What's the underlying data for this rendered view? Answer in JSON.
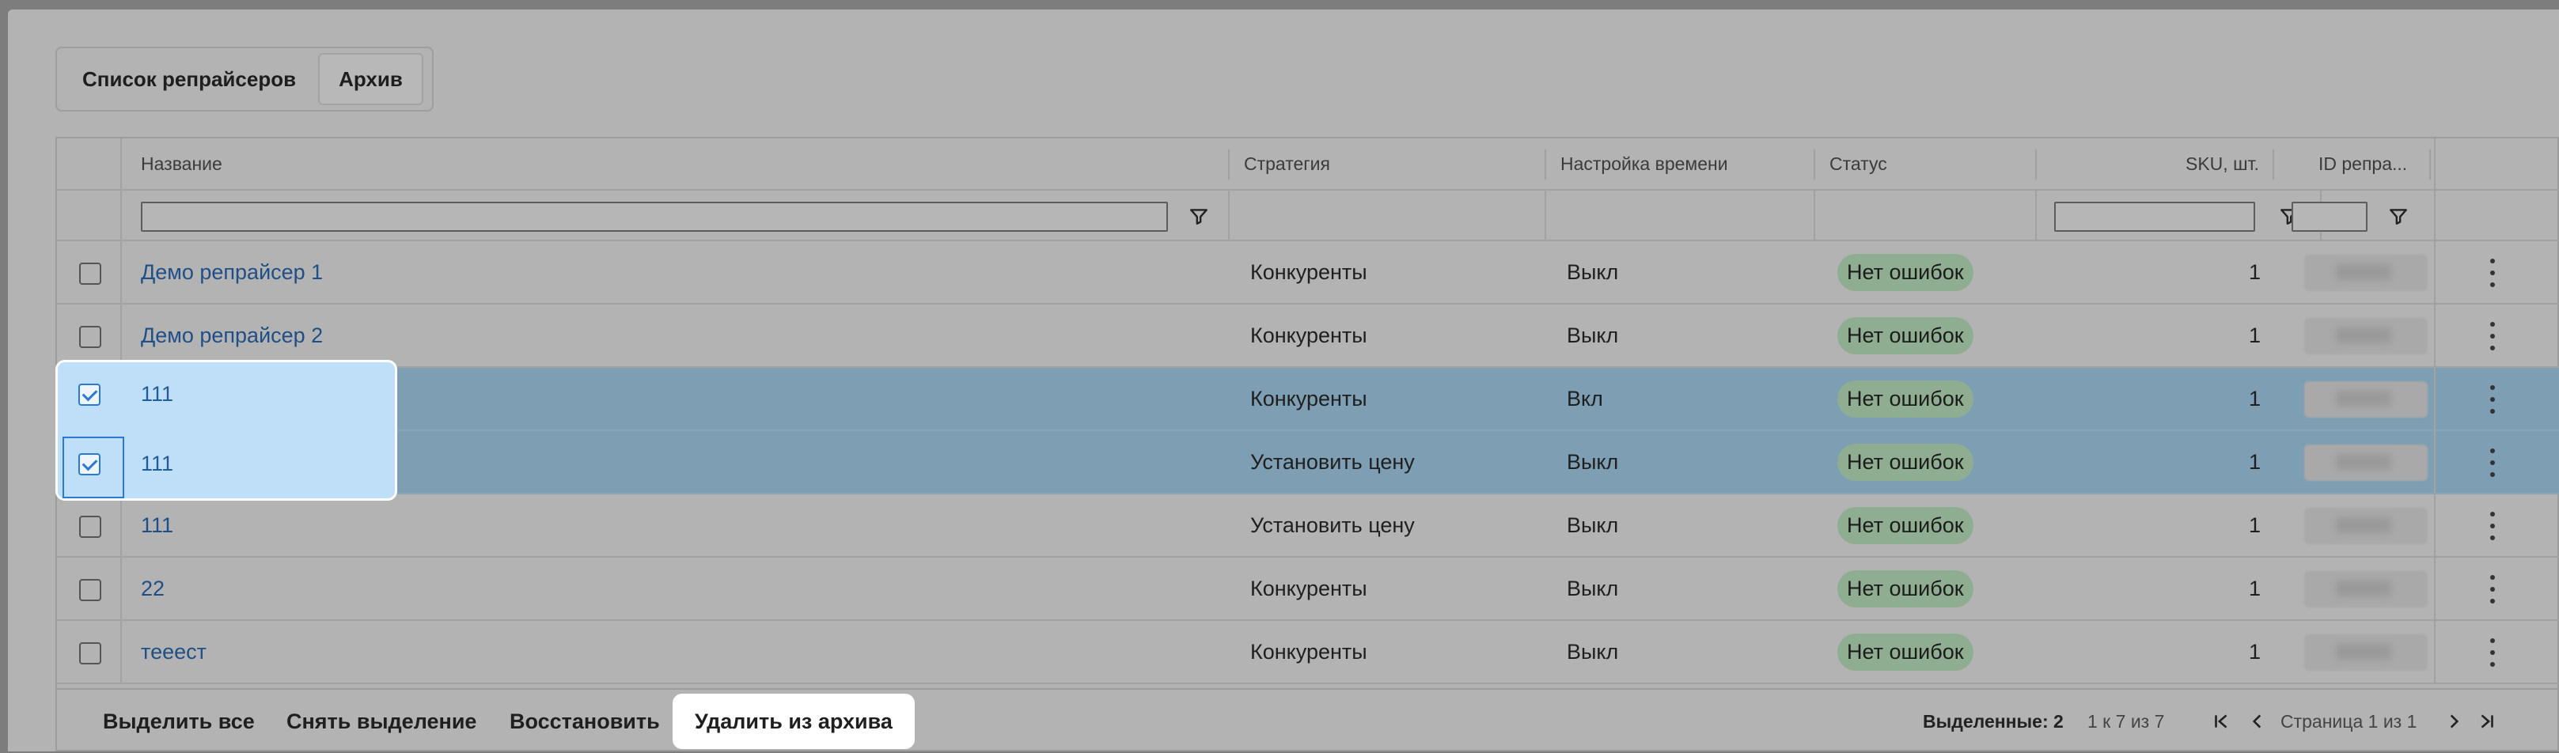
{
  "tabs": {
    "list": "Список репрайсеров",
    "archive": "Архив"
  },
  "columns": {
    "name": "Название",
    "strategy": "Стратегия",
    "time": "Настройка времени",
    "status": "Статус",
    "sku": "SKU, шт.",
    "id": "ID репра..."
  },
  "rows": [
    {
      "name": "Демо репрайсер 1",
      "strategy": "Конкуренты",
      "time": "Выкл",
      "status": "Нет ошибок",
      "sku": "1",
      "checked": false
    },
    {
      "name": "Демо репрайсер 2",
      "strategy": "Конкуренты",
      "time": "Выкл",
      "status": "Нет ошибок",
      "sku": "1",
      "checked": false
    },
    {
      "name": "111",
      "strategy": "Конкуренты",
      "time": "Вкл",
      "status": "Нет ошибок",
      "sku": "1",
      "checked": true
    },
    {
      "name": "111",
      "strategy": "Установить цену",
      "time": "Выкл",
      "status": "Нет ошибок",
      "sku": "1",
      "checked": true
    },
    {
      "name": "111",
      "strategy": "Установить цену",
      "time": "Выкл",
      "status": "Нет ошибок",
      "sku": "1",
      "checked": false
    },
    {
      "name": "22",
      "strategy": "Конкуренты",
      "time": "Выкл",
      "status": "Нет ошибок",
      "sku": "1",
      "checked": false
    },
    {
      "name": "тееест",
      "strategy": "Конкуренты",
      "time": "Выкл",
      "status": "Нет ошибок",
      "sku": "1",
      "checked": false
    }
  ],
  "footer": {
    "select_all": "Выделить все",
    "deselect": "Снять выделение",
    "restore": "Восстановить",
    "delete_from_archive": "Удалить из архива",
    "selected_label": "Выделенные:",
    "selected_count": "2",
    "range": "1 к 7 из 7",
    "page": "Страница 1 из 1"
  },
  "icons": {
    "filter": "filter-icon",
    "more": "more-vertical-icon",
    "first": "first-page-icon",
    "prev": "prev-page-icon",
    "next": "next-page-icon",
    "last": "last-page-icon"
  },
  "colors": {
    "link": "#1f4f86",
    "badge_bg": "#8fad91",
    "selected_row": "#7e9eb3",
    "checkbox_accent": "#2b78d6"
  }
}
